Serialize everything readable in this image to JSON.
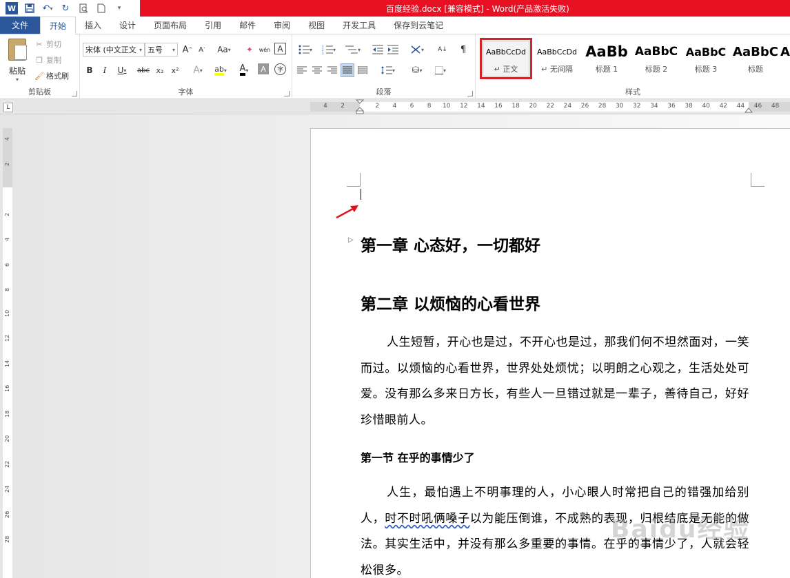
{
  "window": {
    "title": "百度经验.docx [兼容模式] - Word(产品激活失败)",
    "brand_color": "#2b579a",
    "titlebar_color": "#e81123"
  },
  "quick_access": {
    "icons": [
      "word-logo",
      "save-icon",
      "undo-icon",
      "redo-icon",
      "print-preview-icon",
      "new-doc-icon",
      "customize-icon"
    ],
    "logo_letter": "W"
  },
  "tabs": [
    "文件",
    "开始",
    "插入",
    "设计",
    "页面布局",
    "引用",
    "邮件",
    "审阅",
    "视图",
    "开发工具",
    "保存到云笔记"
  ],
  "active_tab": "开始",
  "clipboard": {
    "paste": "粘贴",
    "cut": "剪切",
    "copy": "复制",
    "format_painter": "格式刷",
    "label": "剪贴板"
  },
  "font": {
    "name": "宋体 (中文正文",
    "size": "五号",
    "grow": "A",
    "shrink": "A",
    "case": "Aa",
    "clear": "✦",
    "phonetic": "wén",
    "border": "A",
    "bold": "B",
    "italic": "I",
    "underline": "U",
    "strike": "abc",
    "subscript": "x₂",
    "superscript": "x²",
    "effects": "A",
    "highlight": "ab",
    "color": "A",
    "shading": "A",
    "enclose": "字",
    "label": "字体"
  },
  "paragraph": {
    "label": "段落",
    "sort": "A↓"
  },
  "styles": {
    "label": "样式",
    "items": [
      {
        "sample": "AaBbCcDd",
        "name": "↵ 正文"
      },
      {
        "sample": "AaBbCcDd",
        "name": "↵ 无间隔"
      },
      {
        "sample": "AaBb",
        "name": "标题 1"
      },
      {
        "sample": "AaBbC",
        "name": "标题 2"
      },
      {
        "sample": "AaBbC",
        "name": "标题 3"
      },
      {
        "sample": "AaBbC",
        "name": "标题"
      },
      {
        "sample": "A",
        "name": ""
      }
    ],
    "selected_color": "#d2232a"
  },
  "ruler": {
    "button": "L",
    "h_ticks": [
      "4",
      "2",
      "",
      "2",
      "4",
      "6",
      "8",
      "10",
      "12",
      "14",
      "16",
      "18",
      "20",
      "22",
      "24",
      "26",
      "28",
      "30",
      "32",
      "34",
      "36",
      "38",
      "40",
      "42",
      "44",
      "46",
      "48"
    ],
    "v_ticks": [
      "4",
      "2",
      "",
      "2",
      "4",
      "6",
      "8",
      "10",
      "12",
      "14",
      "16",
      "18",
      "20",
      "22",
      "24",
      "26",
      "28"
    ]
  },
  "document": {
    "heading1": "第一章  心态好，一切都好",
    "heading2": "第二章  以烦恼的心看世界",
    "para1": "人生短暂，开心也是过，不开心也是过，那我们何不坦然面对，一笑而过。以烦恼的心看世界，世界处处烦忧；以明朗之心观之，生活处处可爱。没有那么多来日方长，有些人一旦错过就是一辈子，善待自己，好好珍惜眼前人。",
    "section1": "第一节  在乎的事情少了",
    "para2_a": "人生，最怕遇上不明事理的人，小心眼人时常把自己的错强加给别人，",
    "para2_wavy": "时不时吼俩嗓子",
    "para2_b": "以为能压倒谁，不成熟的表现，归根结底是无能的做法。其实生活中，并没有那么多重要的事情。在乎的事情少了，人就会轻松很多。"
  },
  "watermark": "Baidu经验"
}
